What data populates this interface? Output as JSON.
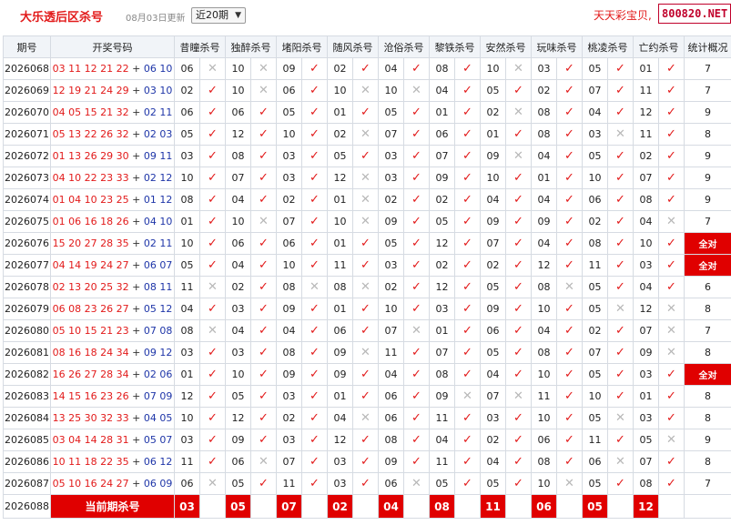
{
  "header": {
    "title": "大乐透后区杀号",
    "update": "08月03日更新",
    "period_select": "近20期",
    "brand": "天天彩宝贝,",
    "site": "800820.NET"
  },
  "table": {
    "columns": [
      "期号",
      "开奖号码",
      "昔瞳杀号",
      "独醉杀号",
      "堵阳杀号",
      "随风杀号",
      "沧俗杀号",
      "黎铁杀号",
      "安然杀号",
      "玩味杀号",
      "桃凌杀号",
      "亡约杀号",
      "统计概况"
    ],
    "rows": [
      {
        "period": "2026068",
        "front": "03 11 12 21 22",
        "back": "06 10",
        "kills": [
          [
            "06",
            0
          ],
          [
            "10",
            0
          ],
          [
            "09",
            1
          ],
          [
            "02",
            1
          ],
          [
            "04",
            1
          ],
          [
            "08",
            1
          ],
          [
            "10",
            0
          ],
          [
            "03",
            1
          ],
          [
            "05",
            1
          ],
          [
            "01",
            1
          ]
        ],
        "stat": "7"
      },
      {
        "period": "2026069",
        "front": "12 19 21 24 29",
        "back": "03 10",
        "kills": [
          [
            "02",
            1
          ],
          [
            "10",
            0
          ],
          [
            "06",
            1
          ],
          [
            "10",
            0
          ],
          [
            "10",
            0
          ],
          [
            "04",
            1
          ],
          [
            "05",
            1
          ],
          [
            "02",
            1
          ],
          [
            "07",
            1
          ],
          [
            "11",
            1
          ]
        ],
        "stat": "7"
      },
      {
        "period": "2026070",
        "front": "04 05 15 21 32",
        "back": "02 11",
        "kills": [
          [
            "06",
            1
          ],
          [
            "06",
            1
          ],
          [
            "05",
            1
          ],
          [
            "01",
            1
          ],
          [
            "05",
            1
          ],
          [
            "01",
            1
          ],
          [
            "02",
            0
          ],
          [
            "08",
            1
          ],
          [
            "04",
            1
          ],
          [
            "12",
            1
          ]
        ],
        "stat": "9"
      },
      {
        "period": "2026071",
        "front": "05 13 22 26 32",
        "back": "02 03",
        "kills": [
          [
            "05",
            1
          ],
          [
            "12",
            1
          ],
          [
            "10",
            1
          ],
          [
            "02",
            0
          ],
          [
            "07",
            1
          ],
          [
            "06",
            1
          ],
          [
            "01",
            1
          ],
          [
            "08",
            1
          ],
          [
            "03",
            0
          ],
          [
            "11",
            1
          ]
        ],
        "stat": "8"
      },
      {
        "period": "2026072",
        "front": "01 13 26 29 30",
        "back": "09 11",
        "kills": [
          [
            "03",
            1
          ],
          [
            "08",
            1
          ],
          [
            "03",
            1
          ],
          [
            "05",
            1
          ],
          [
            "03",
            1
          ],
          [
            "07",
            1
          ],
          [
            "09",
            0
          ],
          [
            "04",
            1
          ],
          [
            "05",
            1
          ],
          [
            "02",
            1
          ]
        ],
        "stat": "9"
      },
      {
        "period": "2026073",
        "front": "04 10 22 23 33",
        "back": "02 12",
        "kills": [
          [
            "10",
            1
          ],
          [
            "07",
            1
          ],
          [
            "03",
            1
          ],
          [
            "12",
            0
          ],
          [
            "03",
            1
          ],
          [
            "09",
            1
          ],
          [
            "10",
            1
          ],
          [
            "01",
            1
          ],
          [
            "10",
            1
          ],
          [
            "07",
            1
          ]
        ],
        "stat": "9"
      },
      {
        "period": "2026074",
        "front": "01 04 10 23 25",
        "back": "01 12",
        "kills": [
          [
            "08",
            1
          ],
          [
            "04",
            1
          ],
          [
            "02",
            1
          ],
          [
            "01",
            0
          ],
          [
            "02",
            1
          ],
          [
            "02",
            1
          ],
          [
            "04",
            1
          ],
          [
            "04",
            1
          ],
          [
            "06",
            1
          ],
          [
            "08",
            1
          ]
        ],
        "stat": "9"
      },
      {
        "period": "2026075",
        "front": "01 06 16 18 26",
        "back": "04 10",
        "kills": [
          [
            "01",
            1
          ],
          [
            "10",
            0
          ],
          [
            "07",
            1
          ],
          [
            "10",
            0
          ],
          [
            "09",
            1
          ],
          [
            "05",
            1
          ],
          [
            "09",
            1
          ],
          [
            "09",
            1
          ],
          [
            "02",
            1
          ],
          [
            "04",
            0
          ]
        ],
        "stat": "7"
      },
      {
        "period": "2026076",
        "front": "15 20 27 28 35",
        "back": "02 11",
        "kills": [
          [
            "10",
            1
          ],
          [
            "06",
            1
          ],
          [
            "06",
            1
          ],
          [
            "01",
            1
          ],
          [
            "05",
            1
          ],
          [
            "12",
            1
          ],
          [
            "07",
            1
          ],
          [
            "04",
            1
          ],
          [
            "08",
            1
          ],
          [
            "10",
            1
          ]
        ],
        "stat": "全对"
      },
      {
        "period": "2026077",
        "front": "04 14 19 24 27",
        "back": "06 07",
        "kills": [
          [
            "05",
            1
          ],
          [
            "04",
            1
          ],
          [
            "10",
            1
          ],
          [
            "11",
            1
          ],
          [
            "03",
            1
          ],
          [
            "02",
            1
          ],
          [
            "02",
            1
          ],
          [
            "12",
            1
          ],
          [
            "11",
            1
          ],
          [
            "03",
            1
          ]
        ],
        "stat": "全对"
      },
      {
        "period": "2026078",
        "front": "02 13 20 25 32",
        "back": "08 11",
        "kills": [
          [
            "11",
            0
          ],
          [
            "02",
            1
          ],
          [
            "08",
            0
          ],
          [
            "08",
            0
          ],
          [
            "02",
            1
          ],
          [
            "12",
            1
          ],
          [
            "05",
            1
          ],
          [
            "08",
            0
          ],
          [
            "05",
            1
          ],
          [
            "04",
            1
          ]
        ],
        "stat": "6"
      },
      {
        "period": "2026079",
        "front": "06 08 23 26 27",
        "back": "05 12",
        "kills": [
          [
            "04",
            1
          ],
          [
            "03",
            1
          ],
          [
            "09",
            1
          ],
          [
            "01",
            1
          ],
          [
            "10",
            1
          ],
          [
            "03",
            1
          ],
          [
            "09",
            1
          ],
          [
            "10",
            1
          ],
          [
            "05",
            0
          ],
          [
            "12",
            0
          ]
        ],
        "stat": "8"
      },
      {
        "period": "2026080",
        "front": "05 10 15 21 23",
        "back": "07 08",
        "kills": [
          [
            "08",
            0
          ],
          [
            "04",
            1
          ],
          [
            "04",
            1
          ],
          [
            "06",
            1
          ],
          [
            "07",
            0
          ],
          [
            "01",
            1
          ],
          [
            "06",
            1
          ],
          [
            "04",
            1
          ],
          [
            "02",
            1
          ],
          [
            "07",
            0
          ]
        ],
        "stat": "7"
      },
      {
        "period": "2026081",
        "front": "08 16 18 24 34",
        "back": "09 12",
        "kills": [
          [
            "03",
            1
          ],
          [
            "03",
            1
          ],
          [
            "08",
            1
          ],
          [
            "09",
            0
          ],
          [
            "11",
            1
          ],
          [
            "07",
            1
          ],
          [
            "05",
            1
          ],
          [
            "08",
            1
          ],
          [
            "07",
            1
          ],
          [
            "09",
            0
          ]
        ],
        "stat": "8"
      },
      {
        "period": "2026082",
        "front": "16 26 27 28 34",
        "back": "02 06",
        "kills": [
          [
            "01",
            1
          ],
          [
            "10",
            1
          ],
          [
            "09",
            1
          ],
          [
            "09",
            1
          ],
          [
            "04",
            1
          ],
          [
            "08",
            1
          ],
          [
            "04",
            1
          ],
          [
            "10",
            1
          ],
          [
            "05",
            1
          ],
          [
            "03",
            1
          ]
        ],
        "stat": "全对"
      },
      {
        "period": "2026083",
        "front": "14 15 16 23 26",
        "back": "07 09",
        "kills": [
          [
            "12",
            1
          ],
          [
            "05",
            1
          ],
          [
            "03",
            1
          ],
          [
            "01",
            1
          ],
          [
            "06",
            1
          ],
          [
            "09",
            0
          ],
          [
            "07",
            0
          ],
          [
            "11",
            1
          ],
          [
            "10",
            1
          ],
          [
            "01",
            1
          ]
        ],
        "stat": "8"
      },
      {
        "period": "2026084",
        "front": "13 25 30 32 33",
        "back": "04 05",
        "kills": [
          [
            "10",
            1
          ],
          [
            "12",
            1
          ],
          [
            "02",
            1
          ],
          [
            "04",
            0
          ],
          [
            "06",
            1
          ],
          [
            "11",
            1
          ],
          [
            "03",
            1
          ],
          [
            "10",
            1
          ],
          [
            "05",
            0
          ],
          [
            "03",
            1
          ]
        ],
        "stat": "8"
      },
      {
        "period": "2026085",
        "front": "03 04 14 28 31",
        "back": "05 07",
        "kills": [
          [
            "03",
            1
          ],
          [
            "09",
            1
          ],
          [
            "03",
            1
          ],
          [
            "12",
            1
          ],
          [
            "08",
            1
          ],
          [
            "04",
            1
          ],
          [
            "02",
            1
          ],
          [
            "06",
            1
          ],
          [
            "11",
            1
          ],
          [
            "05",
            0
          ]
        ],
        "stat": "9"
      },
      {
        "period": "2026086",
        "front": "10 11 18 22 35",
        "back": "06 12",
        "kills": [
          [
            "11",
            1
          ],
          [
            "06",
            0
          ],
          [
            "07",
            1
          ],
          [
            "03",
            1
          ],
          [
            "09",
            1
          ],
          [
            "11",
            1
          ],
          [
            "04",
            1
          ],
          [
            "08",
            1
          ],
          [
            "06",
            0
          ],
          [
            "07",
            1
          ]
        ],
        "stat": "8"
      },
      {
        "period": "2026087",
        "front": "05 10 16 24 27",
        "back": "06 09",
        "kills": [
          [
            "06",
            0
          ],
          [
            "05",
            1
          ],
          [
            "11",
            1
          ],
          [
            "03",
            1
          ],
          [
            "06",
            0
          ],
          [
            "05",
            1
          ],
          [
            "05",
            1
          ],
          [
            "10",
            0
          ],
          [
            "05",
            1
          ],
          [
            "08",
            1
          ]
        ],
        "stat": "7"
      }
    ],
    "current": {
      "period": "2026088",
      "label": "当前期杀号",
      "kills": [
        "03",
        "05",
        "07",
        "02",
        "04",
        "08",
        "11",
        "06",
        "05",
        "12"
      ]
    }
  },
  "symbols": {
    "ok": "✓",
    "ng": "✕"
  },
  "colors": {
    "red": "#e21a1a",
    "blue": "#1e35a8",
    "header_bg": "#f1f4f8",
    "highlight": "#e00000"
  }
}
